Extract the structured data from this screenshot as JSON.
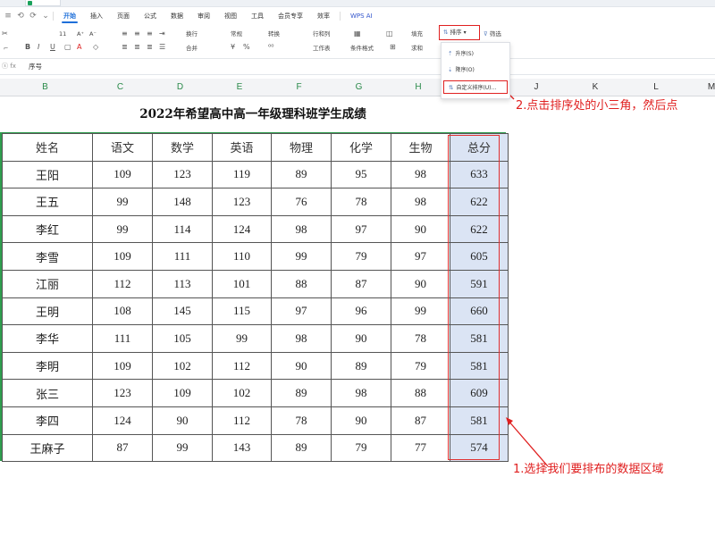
{
  "menu": {
    "glyphs": [
      "≡",
      "⟲",
      "⟳",
      "⌄"
    ],
    "items": [
      "开始",
      "插入",
      "页面",
      "公式",
      "数据",
      "审阅",
      "视图",
      "工具",
      "会员专享",
      "效率",
      "WPS AI"
    ],
    "active_index": 0
  },
  "ribbon": {
    "row1": [
      "11",
      "A⁺",
      "A⁻",
      "换行",
      "常规",
      "转换",
      "行和列",
      "填充"
    ],
    "row2": [
      "合并",
      "工作表",
      "条件格式",
      "求和"
    ],
    "sort_label": "排序",
    "filter_label": "筛选"
  },
  "dropdown": {
    "items": [
      "升序(S)",
      "降序(O)",
      "自定义排序(U)..."
    ]
  },
  "formula_bar": {
    "value": "序号"
  },
  "columns": {
    "in_table": [
      "B",
      "C",
      "D",
      "E",
      "F",
      "G",
      "H"
    ],
    "outside": [
      "J",
      "K",
      "L",
      "M"
    ]
  },
  "sheet": {
    "title": "2022年希望高中高一年级理科班学生成绩",
    "headers": [
      "姓名",
      "语文",
      "数学",
      "英语",
      "物理",
      "化学",
      "生物",
      "总分"
    ],
    "rows": [
      [
        "王阳",
        "109",
        "123",
        "119",
        "89",
        "95",
        "98",
        "633"
      ],
      [
        "王五",
        "99",
        "148",
        "123",
        "76",
        "78",
        "98",
        "622"
      ],
      [
        "李红",
        "99",
        "114",
        "124",
        "98",
        "97",
        "90",
        "622"
      ],
      [
        "李雪",
        "109",
        "111",
        "110",
        "99",
        "79",
        "97",
        "605"
      ],
      [
        "江丽",
        "112",
        "113",
        "101",
        "88",
        "87",
        "90",
        "591"
      ],
      [
        "王明",
        "108",
        "145",
        "115",
        "97",
        "96",
        "99",
        "660"
      ],
      [
        "李华",
        "111",
        "105",
        "99",
        "98",
        "90",
        "78",
        "581"
      ],
      [
        "李明",
        "109",
        "102",
        "112",
        "90",
        "89",
        "79",
        "581"
      ],
      [
        "张三",
        "123",
        "109",
        "102",
        "89",
        "98",
        "88",
        "609"
      ],
      [
        "李四",
        "124",
        "90",
        "112",
        "78",
        "90",
        "87",
        "581"
      ],
      [
        "王麻子",
        "87",
        "99",
        "143",
        "89",
        "79",
        "77",
        "574"
      ]
    ]
  },
  "annotations": {
    "step1": "1.选择我们要排布的数据区域",
    "step2": "2.点击排序处的小三角，然后点"
  },
  "colors": {
    "accent": "#1e6fd9",
    "annotation_red": "#e02020",
    "selection_fill": "#dbe4f4",
    "column_green": "#2a8a4a"
  }
}
